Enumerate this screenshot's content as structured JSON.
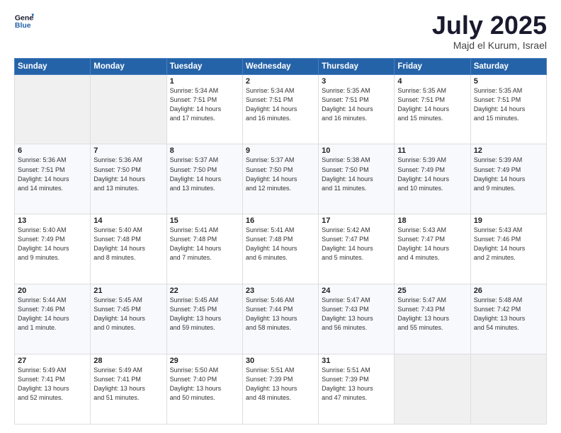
{
  "header": {
    "logo_general": "General",
    "logo_blue": "Blue",
    "month": "July 2025",
    "location": "Majd el Kurum, Israel"
  },
  "days_of_week": [
    "Sunday",
    "Monday",
    "Tuesday",
    "Wednesday",
    "Thursday",
    "Friday",
    "Saturday"
  ],
  "weeks": [
    [
      {
        "day": "",
        "info": ""
      },
      {
        "day": "",
        "info": ""
      },
      {
        "day": "1",
        "info": "Sunrise: 5:34 AM\nSunset: 7:51 PM\nDaylight: 14 hours\nand 17 minutes."
      },
      {
        "day": "2",
        "info": "Sunrise: 5:34 AM\nSunset: 7:51 PM\nDaylight: 14 hours\nand 16 minutes."
      },
      {
        "day": "3",
        "info": "Sunrise: 5:35 AM\nSunset: 7:51 PM\nDaylight: 14 hours\nand 16 minutes."
      },
      {
        "day": "4",
        "info": "Sunrise: 5:35 AM\nSunset: 7:51 PM\nDaylight: 14 hours\nand 15 minutes."
      },
      {
        "day": "5",
        "info": "Sunrise: 5:35 AM\nSunset: 7:51 PM\nDaylight: 14 hours\nand 15 minutes."
      }
    ],
    [
      {
        "day": "6",
        "info": "Sunrise: 5:36 AM\nSunset: 7:51 PM\nDaylight: 14 hours\nand 14 minutes."
      },
      {
        "day": "7",
        "info": "Sunrise: 5:36 AM\nSunset: 7:50 PM\nDaylight: 14 hours\nand 13 minutes."
      },
      {
        "day": "8",
        "info": "Sunrise: 5:37 AM\nSunset: 7:50 PM\nDaylight: 14 hours\nand 13 minutes."
      },
      {
        "day": "9",
        "info": "Sunrise: 5:37 AM\nSunset: 7:50 PM\nDaylight: 14 hours\nand 12 minutes."
      },
      {
        "day": "10",
        "info": "Sunrise: 5:38 AM\nSunset: 7:50 PM\nDaylight: 14 hours\nand 11 minutes."
      },
      {
        "day": "11",
        "info": "Sunrise: 5:39 AM\nSunset: 7:49 PM\nDaylight: 14 hours\nand 10 minutes."
      },
      {
        "day": "12",
        "info": "Sunrise: 5:39 AM\nSunset: 7:49 PM\nDaylight: 14 hours\nand 9 minutes."
      }
    ],
    [
      {
        "day": "13",
        "info": "Sunrise: 5:40 AM\nSunset: 7:49 PM\nDaylight: 14 hours\nand 9 minutes."
      },
      {
        "day": "14",
        "info": "Sunrise: 5:40 AM\nSunset: 7:48 PM\nDaylight: 14 hours\nand 8 minutes."
      },
      {
        "day": "15",
        "info": "Sunrise: 5:41 AM\nSunset: 7:48 PM\nDaylight: 14 hours\nand 7 minutes."
      },
      {
        "day": "16",
        "info": "Sunrise: 5:41 AM\nSunset: 7:48 PM\nDaylight: 14 hours\nand 6 minutes."
      },
      {
        "day": "17",
        "info": "Sunrise: 5:42 AM\nSunset: 7:47 PM\nDaylight: 14 hours\nand 5 minutes."
      },
      {
        "day": "18",
        "info": "Sunrise: 5:43 AM\nSunset: 7:47 PM\nDaylight: 14 hours\nand 4 minutes."
      },
      {
        "day": "19",
        "info": "Sunrise: 5:43 AM\nSunset: 7:46 PM\nDaylight: 14 hours\nand 2 minutes."
      }
    ],
    [
      {
        "day": "20",
        "info": "Sunrise: 5:44 AM\nSunset: 7:46 PM\nDaylight: 14 hours\nand 1 minute."
      },
      {
        "day": "21",
        "info": "Sunrise: 5:45 AM\nSunset: 7:45 PM\nDaylight: 14 hours\nand 0 minutes."
      },
      {
        "day": "22",
        "info": "Sunrise: 5:45 AM\nSunset: 7:45 PM\nDaylight: 13 hours\nand 59 minutes."
      },
      {
        "day": "23",
        "info": "Sunrise: 5:46 AM\nSunset: 7:44 PM\nDaylight: 13 hours\nand 58 minutes."
      },
      {
        "day": "24",
        "info": "Sunrise: 5:47 AM\nSunset: 7:43 PM\nDaylight: 13 hours\nand 56 minutes."
      },
      {
        "day": "25",
        "info": "Sunrise: 5:47 AM\nSunset: 7:43 PM\nDaylight: 13 hours\nand 55 minutes."
      },
      {
        "day": "26",
        "info": "Sunrise: 5:48 AM\nSunset: 7:42 PM\nDaylight: 13 hours\nand 54 minutes."
      }
    ],
    [
      {
        "day": "27",
        "info": "Sunrise: 5:49 AM\nSunset: 7:41 PM\nDaylight: 13 hours\nand 52 minutes."
      },
      {
        "day": "28",
        "info": "Sunrise: 5:49 AM\nSunset: 7:41 PM\nDaylight: 13 hours\nand 51 minutes."
      },
      {
        "day": "29",
        "info": "Sunrise: 5:50 AM\nSunset: 7:40 PM\nDaylight: 13 hours\nand 50 minutes."
      },
      {
        "day": "30",
        "info": "Sunrise: 5:51 AM\nSunset: 7:39 PM\nDaylight: 13 hours\nand 48 minutes."
      },
      {
        "day": "31",
        "info": "Sunrise: 5:51 AM\nSunset: 7:39 PM\nDaylight: 13 hours\nand 47 minutes."
      },
      {
        "day": "",
        "info": ""
      },
      {
        "day": "",
        "info": ""
      }
    ]
  ]
}
